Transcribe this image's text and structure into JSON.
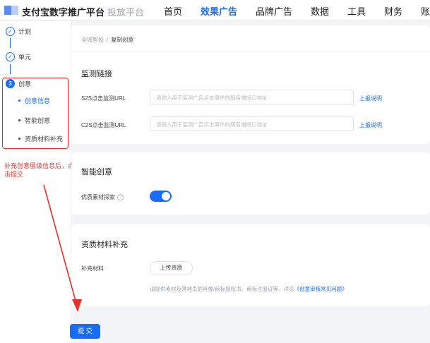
{
  "header": {
    "brand": "支付宝数字推广平台",
    "brand_sub": "投放平台",
    "nav": [
      "首页",
      "效果广告",
      "品牌广告",
      "数据",
      "工具",
      "财务",
      "账户"
    ],
    "active_nav": "效果广告"
  },
  "sidebar": {
    "steps": [
      {
        "marker": "✓",
        "label": "计划"
      },
      {
        "marker": "✓",
        "label": "单元"
      },
      {
        "marker": "3",
        "label": "创意"
      }
    ],
    "sub_items": [
      "创意信息",
      "智能创意",
      "资质材料补充"
    ],
    "active_sub": "创意信息",
    "annotation": "补充创意层级信息后，点击提交"
  },
  "breadcrumb": {
    "parent": "全域智投",
    "separator": "/",
    "current": "复制创意"
  },
  "monitoring": {
    "title": "监测链接",
    "fields": [
      {
        "label": "S2S点击监测URL",
        "placeholder": "请输入用于监测广告点击事件的服务端接口地址",
        "link": "上报说明"
      },
      {
        "label": "C2S点击监测URL",
        "placeholder": "请输入用于监测广告点击事件的服务端接口地址",
        "link": "上报说明"
      }
    ]
  },
  "smart_creative": {
    "title": "智能创意",
    "option_label": "优质素材探索",
    "help_icon": "?",
    "toggle_on": true
  },
  "qualification": {
    "title": "资质材料补充",
    "field_label": "补充材料",
    "upload_label": "上传资质",
    "note_prefix": "请提供素材及落地页的肖像/商标授权书、商标注册证等，详见",
    "note_link": "《创意审核常见问题》"
  },
  "submit_label": "提 交",
  "colors": {
    "accent": "#1a6cf5",
    "annotation": "#e8312a"
  }
}
